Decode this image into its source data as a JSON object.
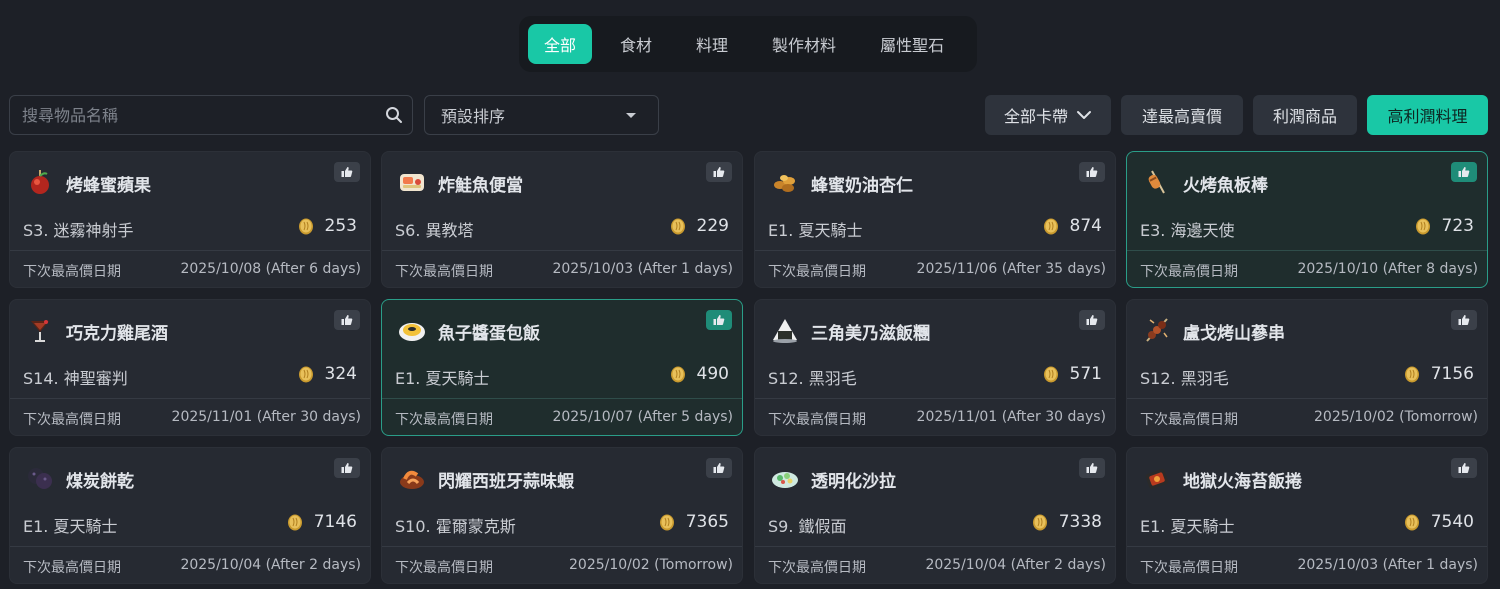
{
  "tabs": [
    "全部",
    "食材",
    "料理",
    "製作材料",
    "屬性聖石"
  ],
  "search": {
    "placeholder": "搜尋物品名稱",
    "icon": "search-icon"
  },
  "sort": {
    "value": "預設排序"
  },
  "filters": {
    "card_band": "全部卡帶",
    "max_price": "達最高賣價",
    "profit_items": "利潤商品",
    "high_profit_cuisine": "高利潤料理"
  },
  "colors": {
    "accent": "#19c8a6",
    "background": "#1d2027",
    "card": "#262a32"
  },
  "date_label": "下次最高價日期",
  "items": [
    {
      "name": "烤蜂蜜蘋果",
      "location": "S3. 迷霧神射手",
      "price": "253",
      "date": "2025/10/08 (After 6 days)",
      "icon": "candied-apple-icon",
      "highlight": false
    },
    {
      "name": "炸鮭魚便當",
      "location": "S6. 異教塔",
      "price": "229",
      "date": "2025/10/03 (After 1 days)",
      "icon": "salmon-bento-icon",
      "highlight": false
    },
    {
      "name": "蜂蜜奶油杏仁",
      "location": "E1. 夏天騎士",
      "price": "874",
      "date": "2025/11/06 (After 35 days)",
      "icon": "honey-almond-icon",
      "highlight": false
    },
    {
      "name": "火烤魚板棒",
      "location": "E3. 海邊天使",
      "price": "723",
      "date": "2025/10/10 (After 8 days)",
      "icon": "fishcake-skewer-icon",
      "highlight": true
    },
    {
      "name": "巧克力雞尾酒",
      "location": "S14. 神聖審判",
      "price": "324",
      "date": "2025/11/01 (After 30 days)",
      "icon": "cocktail-icon",
      "highlight": false
    },
    {
      "name": "魚子醬蛋包飯",
      "location": "E1. 夏天騎士",
      "price": "490",
      "date": "2025/10/07 (After 5 days)",
      "icon": "omurice-icon",
      "highlight": true
    },
    {
      "name": "三角美乃滋飯糰",
      "location": "S12. 黑羽毛",
      "price": "571",
      "date": "2025/11/01 (After 30 days)",
      "icon": "onigiri-icon",
      "highlight": false
    },
    {
      "name": "盧戈烤山蔘串",
      "location": "S12. 黑羽毛",
      "price": "7156",
      "date": "2025/10/02 (Tomorrow)",
      "icon": "ginseng-skewer-icon",
      "highlight": false
    },
    {
      "name": "煤炭餅乾",
      "location": "E1. 夏天騎士",
      "price": "7146",
      "date": "2025/10/04 (After 2 days)",
      "icon": "coal-cookie-icon",
      "highlight": false
    },
    {
      "name": "閃耀西班牙蒜味蝦",
      "location": "S10. 霍爾蒙克斯",
      "price": "7365",
      "date": "2025/10/02 (Tomorrow)",
      "icon": "garlic-shrimp-icon",
      "highlight": false
    },
    {
      "name": "透明化沙拉",
      "location": "S9. 鐵假面",
      "price": "7338",
      "date": "2025/10/04 (After 2 days)",
      "icon": "salad-icon",
      "highlight": false
    },
    {
      "name": "地獄火海苔飯捲",
      "location": "E1. 夏天騎士",
      "price": "7540",
      "date": "2025/10/03 (After 1 days)",
      "icon": "seaweed-roll-icon",
      "highlight": false
    }
  ]
}
